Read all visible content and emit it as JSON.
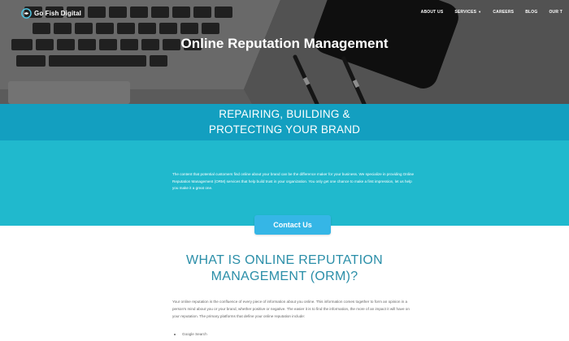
{
  "brand": {
    "name": "Go Fish Digital"
  },
  "nav": {
    "items": [
      {
        "label": "ABOUT US"
      },
      {
        "label": "SERVICES",
        "dropdown": true
      },
      {
        "label": "CAREERS"
      },
      {
        "label": "BLOG"
      },
      {
        "label": "OUR T"
      }
    ]
  },
  "hero": {
    "title": "Online Reputation Management"
  },
  "band": {
    "headline_line1": "REPAIRING, BUILDING &",
    "headline_line2": "PROTECTING YOUR BRAND",
    "paragraph": "The content that potential customers find online about your brand can be the difference maker for your business. We specialize in providing Online Reputation Management (ORM) services that help build trust in your organization. You only get one chance to make a first impression, let us help you make it a great one."
  },
  "cta": {
    "label": "Contact Us"
  },
  "what": {
    "title_line1": "WHAT IS ONLINE REPUTATION",
    "title_line2": "MANAGEMENT (ORM)?",
    "paragraph": "Your online reputation is the confluence of every piece of information about you online. This information comes together to form an opinion in a person's mind about you or your brand, whether positive or negative. The easier it is to find the information, the more of an impact it will have on your reputation. The primary platforms that define your online reputation include:",
    "list": [
      "Google Search"
    ]
  },
  "colors": {
    "band_dark": "#139fc0",
    "band_light": "#20b9cd",
    "cta": "#35b6e6",
    "heading": "#2a8ea8"
  }
}
